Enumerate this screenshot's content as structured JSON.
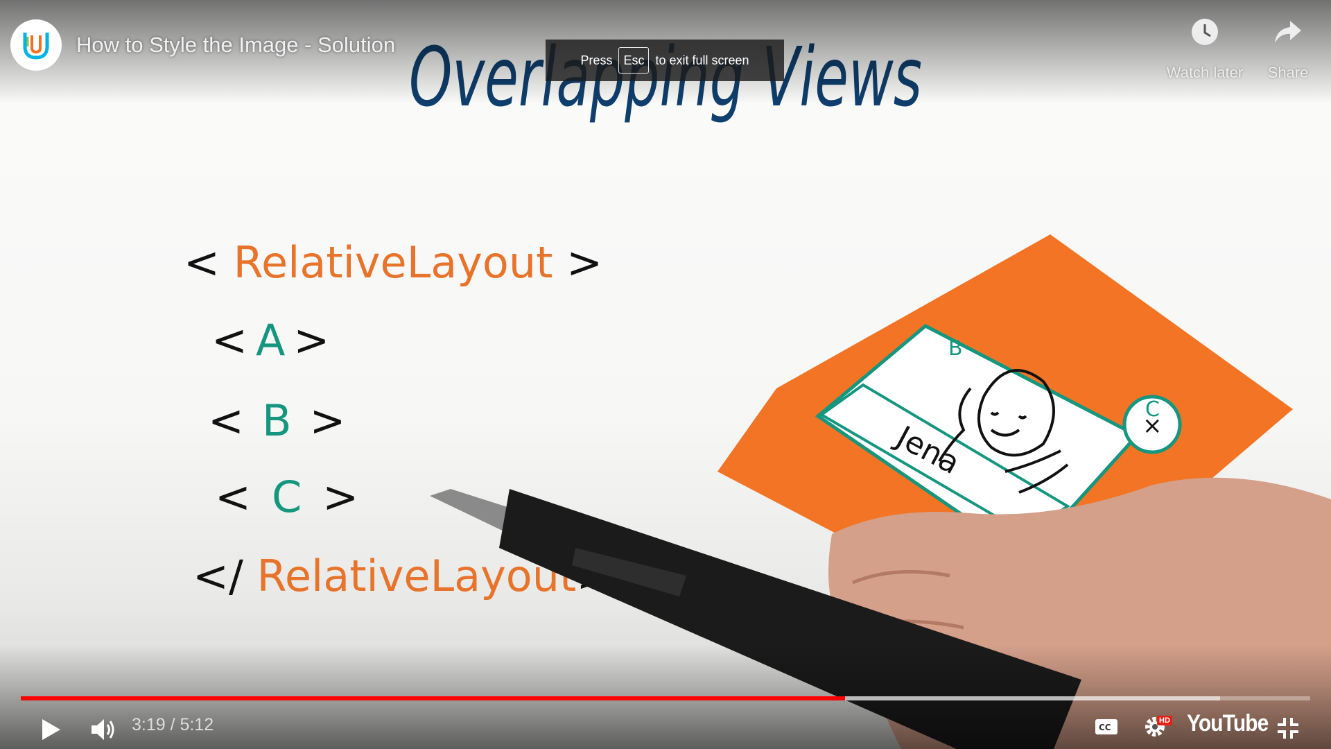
{
  "player": {
    "title": "How to Style the Image - Solution",
    "actions": [
      {
        "label": "Watch later",
        "icon": "clock-icon"
      },
      {
        "label": "Share",
        "icon": "share-arrow-icon"
      }
    ],
    "toast": {
      "before": "Press",
      "key": "Esc",
      "after": "to exit full screen"
    },
    "progress": {
      "played_fraction": 0.639,
      "buffered_fraction": 0.93
    },
    "time": "3:19 / 5:12",
    "logo_text": "YouTube",
    "hd_badge": "HD",
    "colors": {
      "progress_played": "#ff0000",
      "hd_badge": "#e62117"
    }
  },
  "video_content": {
    "heading": "Overlapping Views",
    "code_lines": [
      "< RelativeLayout >",
      "<A>",
      "< B >",
      "< C >",
      "</ RelativeLayout>"
    ],
    "card_labels": [
      "B",
      "C",
      "Jena"
    ],
    "colors": {
      "heading": "#0f3f6e",
      "tag_name": "#e8732a",
      "view_letter": "#14967f",
      "card": "#f26f1d"
    }
  }
}
